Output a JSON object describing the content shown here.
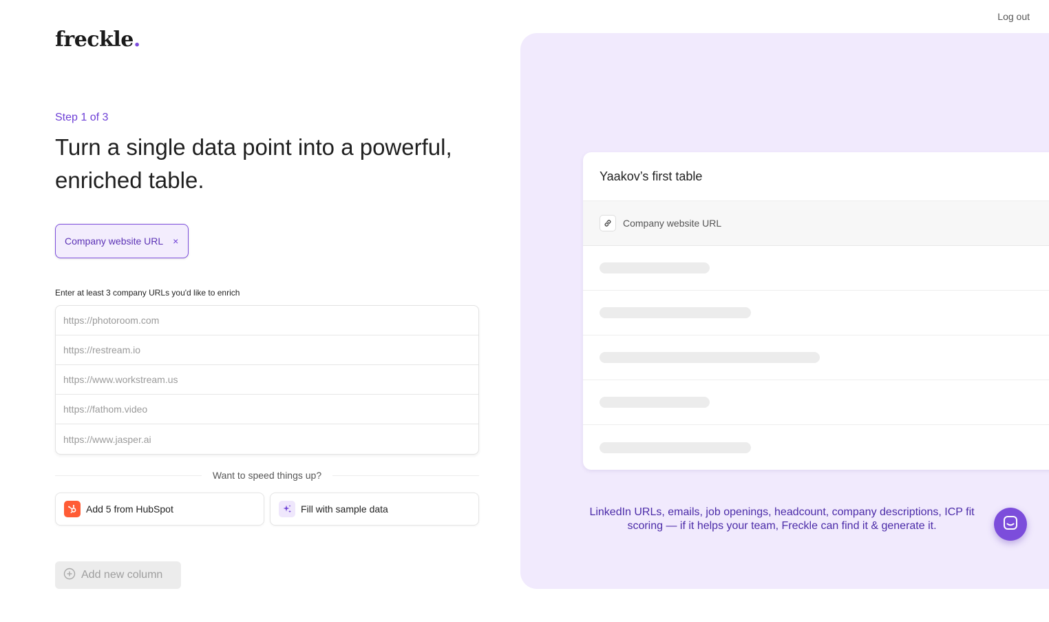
{
  "header": {
    "logo_text": "freckle",
    "logo_dot": ".",
    "logout_label": "Log out"
  },
  "main": {
    "step_label": "Step 1 of 3",
    "headline": "Turn a single data point into a powerful, enriched table.",
    "column_chip": {
      "label": "Company website URL",
      "remove_symbol": "×"
    },
    "url_instruction": "Enter at least 3 company URLs you'd like to enrich",
    "url_inputs": [
      {
        "value": "",
        "placeholder": "https://photoroom.com"
      },
      {
        "value": "",
        "placeholder": "https://restream.io"
      },
      {
        "value": "",
        "placeholder": "https://www.workstream.us"
      },
      {
        "value": "",
        "placeholder": "https://fathom.video"
      },
      {
        "value": "",
        "placeholder": "https://www.jasper.ai"
      }
    ],
    "divider_text": "Want to speed things up?",
    "hubspot_button": {
      "label": "Add 5 from HubSpot",
      "icon": "hubspot-icon"
    },
    "sample_button": {
      "label": "Fill with sample data",
      "icon": "sparkles-icon"
    },
    "add_column_button": {
      "label": "Add new column",
      "icon": "plus-circle-icon",
      "disabled": true
    }
  },
  "preview": {
    "table_title": "Yaakov’s first table",
    "column_header": {
      "label": "Company website URL",
      "icon": "link-icon"
    },
    "placeholder_row_count": 5,
    "caption": "LinkedIn URLs, emails, job openings, headcount, company descriptions, ICP fit scoring — if it helps your team, Freckle can find it & generate it."
  },
  "chat": {
    "icon": "chat-icon"
  },
  "colors": {
    "accent": "#7c4ddb",
    "accent_text": "#6d3fd6",
    "panel_background": "#f1eafd",
    "hubspot_orange": "#ff5c35"
  }
}
